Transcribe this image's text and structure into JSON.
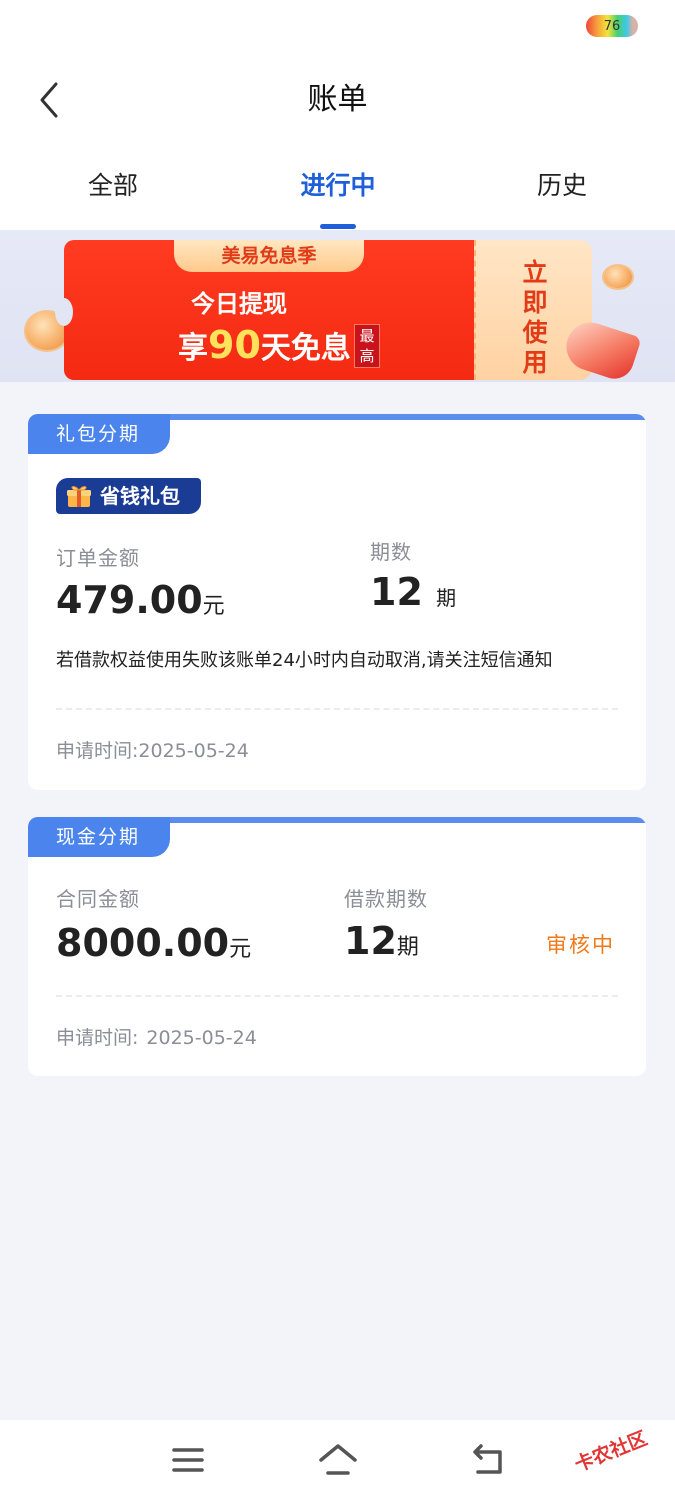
{
  "status_bar": {
    "battery_level": "76"
  },
  "header": {
    "title": "账单"
  },
  "tabs": [
    {
      "label": "全部",
      "active": false
    },
    {
      "label": "进行中",
      "active": true
    },
    {
      "label": "历史",
      "active": false
    }
  ],
  "banner": {
    "tag": "美易免息季",
    "line1": "今日提现",
    "line2_prefix": "享",
    "line2_number": "90",
    "line2_suffix": "天免息",
    "badge": "最高",
    "cta": "立即使用"
  },
  "cards": [
    {
      "tag": "礼包分期",
      "gift_badge": "省钱礼包",
      "amount_label": "订单金额",
      "amount": "479.00",
      "amount_unit": "元",
      "periods_label": "期数",
      "periods": "12",
      "periods_unit": "期",
      "notice": "若借款权益使用失败该账单24小时内自动取消,请关注短信通知",
      "time_label": "申请时间:",
      "time": "2025-05-24"
    },
    {
      "tag": "现金分期",
      "amount_label": "合同金额",
      "amount": "8000.00",
      "amount_unit": "元",
      "periods_label": "借款期数",
      "periods": "12",
      "periods_unit": "期",
      "status": "审核中",
      "time_label": "申请时间:",
      "time": "2025-05-24"
    }
  ],
  "navbar": {
    "icons": [
      "menu-icon",
      "home-icon",
      "back-icon"
    ]
  },
  "watermark": "卡农社区",
  "colors": {
    "accent": "#1f5fd9",
    "tag_blue": "#4a84ec",
    "status_orange": "#f07a1a",
    "banner_red": "#f42a12"
  }
}
